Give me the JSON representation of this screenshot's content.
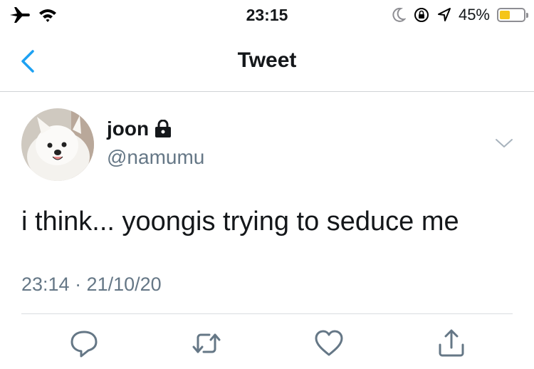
{
  "status_bar": {
    "time": "23:15",
    "battery_percent": "45%",
    "battery_level": 0.45,
    "icons_left": [
      "airplane-icon",
      "wifi-icon"
    ],
    "icons_right": [
      "moon-icon",
      "rotation-lock-icon",
      "location-icon",
      "battery-icon"
    ]
  },
  "nav": {
    "title": "Tweet",
    "back_icon": "chevron-left-icon",
    "accent_color": "#1da1f2"
  },
  "tweet": {
    "display_name": "joon",
    "protected_icon": "lock-icon",
    "handle": "@namumu",
    "text": "i think... yoongis trying to seduce me",
    "timestamp": "23:14 · 21/10/20",
    "menu_icon": "chevron-down-icon"
  },
  "actions": [
    {
      "name": "reply",
      "icon": "reply-icon"
    },
    {
      "name": "retweet",
      "icon": "retweet-icon"
    },
    {
      "name": "like",
      "icon": "heart-icon"
    },
    {
      "name": "share",
      "icon": "share-icon"
    }
  ],
  "colors": {
    "text": "#14171a",
    "secondary_text": "#657786",
    "accent": "#1da1f2",
    "battery_fill": "#f5c518"
  }
}
